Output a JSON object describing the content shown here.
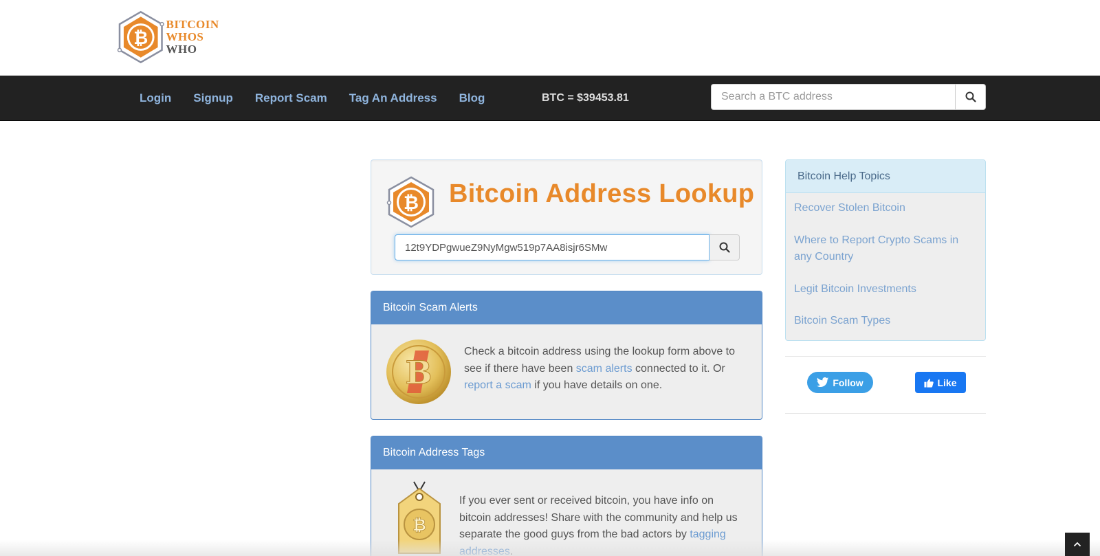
{
  "logo": {
    "line1": "BITCOIN",
    "line2a": "WHOS ",
    "line2b": "WHO",
    "icon": "bitcoin-hexagon-logo"
  },
  "nav": {
    "links": [
      "Login",
      "Signup",
      "Report Scam",
      "Tag An Address",
      "Blog"
    ],
    "btc_price": "BTC = $39453.81",
    "search_placeholder": "Search a BTC address",
    "search_icon": "search-icon"
  },
  "lookup": {
    "title": "Bitcoin Address Lookup",
    "input_value": "12t9YDPgwueZ9NyMgw519p7AA8isjr6SMw",
    "search_icon": "search-icon"
  },
  "alerts": {
    "heading": "Bitcoin Scam Alerts",
    "text_1": "Check a bitcoin address using the lookup form above to see if there have been ",
    "link_1": "scam alerts",
    "text_2": " connected to it. Or ",
    "link_2": "report a scam",
    "text_3": " if you have details on one."
  },
  "tags": {
    "heading": "Bitcoin Address Tags",
    "text_1": "If you ever sent or received bitcoin, you have info on bitcoin addresses! Share with the community and help us separate the good guys from the bad actors by ",
    "link_1": "tagging addresses",
    "text_2": "."
  },
  "sidebar": {
    "heading": "Bitcoin Help Topics",
    "items": [
      "Recover Stolen Bitcoin",
      "Where to Report Crypto Scams in any Country",
      "Legit Bitcoin Investments",
      "Bitcoin Scam Types"
    ]
  },
  "social": {
    "twitter_label": "Follow",
    "facebook_label": "Like"
  },
  "colors": {
    "brand_orange": "#e8892a",
    "navbar": "#222222",
    "nav_link": "#8fb4dd",
    "panel_blue": "#5b8ec9",
    "link": "#6b9bd1"
  }
}
